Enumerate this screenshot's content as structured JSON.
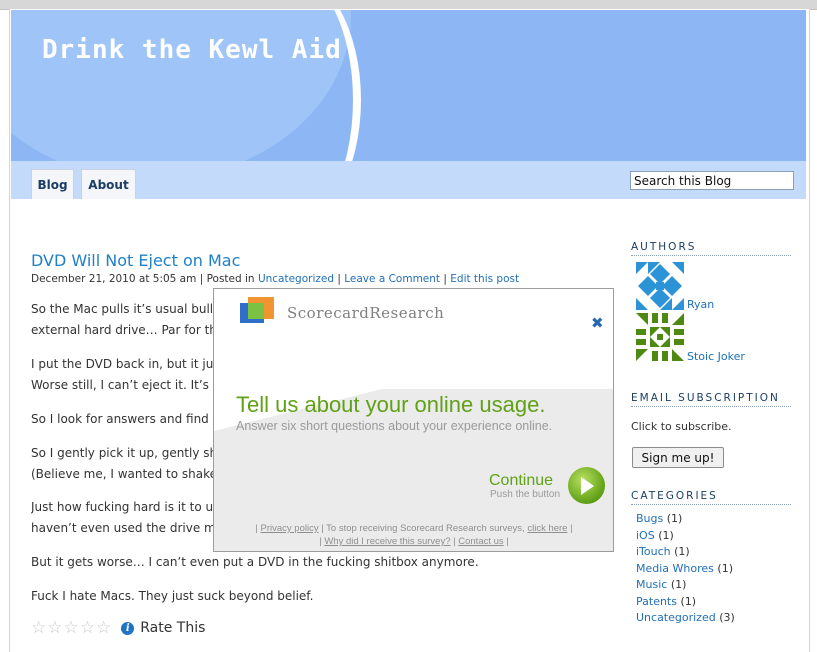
{
  "site": {
    "title": "Drink the Kewl Aid"
  },
  "nav": {
    "tabs": [
      {
        "label": "Blog"
      },
      {
        "label": "About"
      }
    ]
  },
  "search": {
    "value": "Search this Blog"
  },
  "post": {
    "title": "DVD Will Not Eject on Mac",
    "meta": {
      "date": "December 21, 2010 at 5:05 am",
      "posted_in": "| Posted in",
      "category": "Uncategorized",
      "comment_link": "Leave a Comment",
      "edit_link": "Edit this post"
    },
    "paragraphs": [
      "So the Mac pulls it’s usual bulls",
      "external hard drive… Par for th",
      "I put the DVD back in, but it ju",
      "Worse still, I can’t eject it. It’s",
      "So I look for answers and find t",
      "So I gently pick it up, gently sh",
      "(Believe me, I wanted to shake",
      "Just how fucking hard is it to u",
      "haven’t even used the drive m",
      "But it gets worse… I can’t even put a DVD in the fucking shitbox anymore.",
      "Fuck I hate Macs. They just suck beyond belief."
    ],
    "rating": {
      "stars": 0,
      "max_stars": 5,
      "label": "Rate This"
    }
  },
  "sidebar": {
    "authors_heading": "AUTHORS",
    "authors": [
      {
        "name": "Ryan",
        "avatar_color": "#2b93d6"
      },
      {
        "name": "Stoic Joker",
        "avatar_color": "#4e8a12"
      }
    ],
    "email_heading": "EMAIL SUBSCRIPTION",
    "email_text": "Click to subscribe.",
    "signup_label": "Sign me up!",
    "categories_heading": "CATEGORIES",
    "categories": [
      {
        "name": "Bugs",
        "count": "(1)"
      },
      {
        "name": "iOS",
        "count": "(1)"
      },
      {
        "name": "iTouch",
        "count": "(1)"
      },
      {
        "name": "Media Whores",
        "count": "(1)"
      },
      {
        "name": "Music",
        "count": "(1)"
      },
      {
        "name": "Patents",
        "count": "(1)"
      },
      {
        "name": "Uncategorized",
        "count": "(3)"
      }
    ]
  },
  "survey": {
    "logo_text": "ScorecardResearch",
    "close_symbol": "✖",
    "headline": "Tell us about your online usage.",
    "subtext": "Answer six short questions about your experience online.",
    "continue_label": "Continue",
    "push_label": "Push the button",
    "footer": {
      "sep1": "|",
      "privacy": "Privacy policy",
      "mid": "| To stop receiving Scorecard Research surveys,",
      "click_here": "click here",
      "sep2": "|",
      "why": "Why did I receive this survey?",
      "sep3": "|",
      "contact": "Contact us",
      "sep4": "|"
    }
  },
  "colors": {
    "header": "#8db7f4",
    "navbar": "#c4dafb",
    "link": "#1f6fb8",
    "survey_green": "#60a117"
  }
}
